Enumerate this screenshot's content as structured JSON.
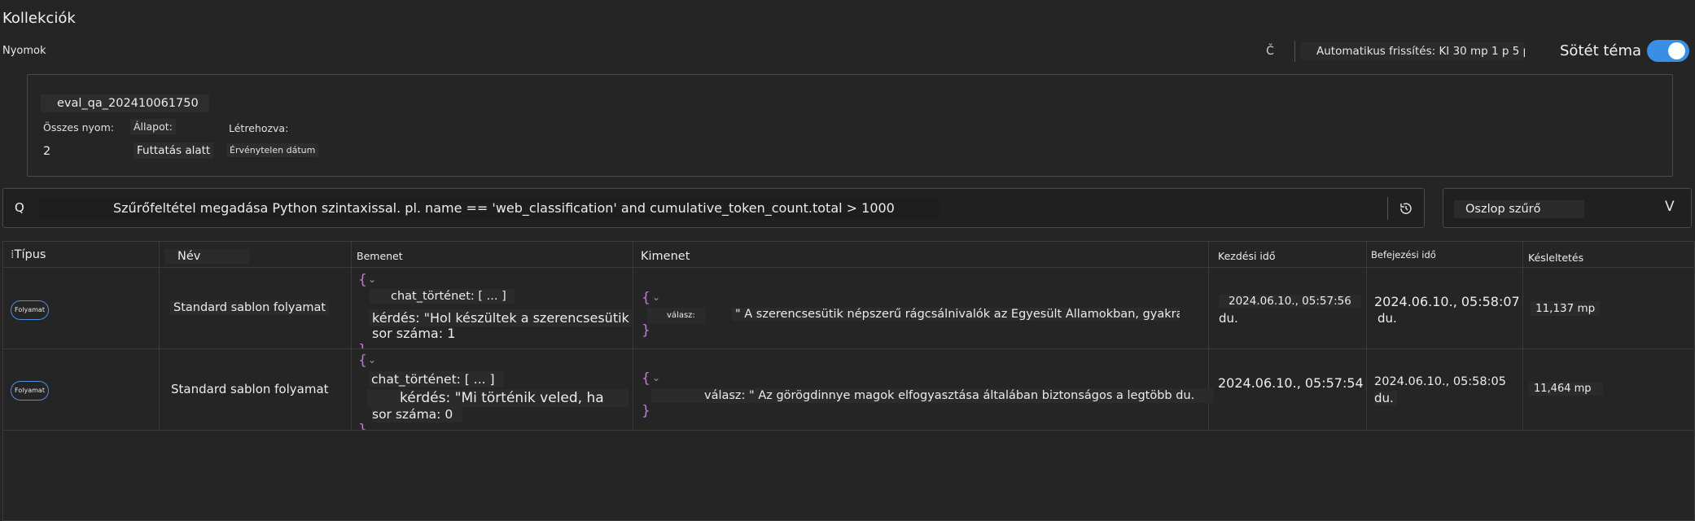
{
  "page": {
    "title": "Kollekciók",
    "subtitle": "Nyomok"
  },
  "toolbar": {
    "refresh_glyph": "Č",
    "auto_refresh": "Automatikus frissítés: KI 30 mp 1 p 5 p",
    "dark_theme_label": "Sötét téma",
    "dark_theme_on": true,
    "accent": "#3a8ee6"
  },
  "run": {
    "id": "eval_qa_202410061750",
    "total_traces_label": "Összes nyom:",
    "total_traces": "2",
    "status_label": "Állapot:",
    "status": "Futtatás alatt",
    "created_label": "Létrehozva:",
    "created": "Érvénytelen dátum"
  },
  "filter": {
    "search_glyph": "Q",
    "placeholder": "Szűrőfeltétel megadása Python szintaxissal. pl. name == 'web_classification' and cumulative_token_count.total > 1000",
    "history_icon": "history-icon",
    "column_filter": "Oszlop szűrő",
    "column_filter_chevron": "V"
  },
  "table": {
    "columns": {
      "type": "Típus",
      "name": "Név",
      "input": "Bemenet",
      "output": "Kimenet",
      "start": "Kezdési idő",
      "end": "Befejezési idő",
      "latency": "Késleltetés"
    },
    "rows": [
      {
        "type": "Folyamat",
        "name": "Standard sablon folyamat",
        "input_open": "{",
        "input_history": "chat_történet: [ ... ]",
        "input_question": "kérdés: \"Hol készültek a szerencsesütik",
        "input_line": "sor száma: 1",
        "input_close": "}",
        "output_open": "{",
        "output_key": "válasz:",
        "output_value": "\" A szerencsesütik népszerű rágcsálnivalók az Egyesült Államokban, gyakran",
        "output_close": "}",
        "start_line1": "2024.06.10., 05:57:56",
        "start_line2": "du.",
        "end_line1": "2024.06.10., 05:58:07",
        "end_line2": "du.",
        "latency": "11,137 mp"
      },
      {
        "type": "Folyamat",
        "name": "Standard sablon folyamat",
        "input_open": "{",
        "input_history": "chat_történet: [ ... ]",
        "input_question": "kérdés: \"Mi történik veled, ha",
        "input_line": "sor száma: 0",
        "input_close": "}",
        "output_open": "{",
        "output_key": "válasz:",
        "output_value": "\" Az görögdinnye magok elfogyasztása általában biztonságos a legtöbb du.",
        "output_close": "}",
        "start_line1": "2024.06.10., 05:57:54",
        "start_line2": "",
        "end_line1": "2024.06.10., 05:58:05",
        "end_line2": "du.",
        "latency": "11,464 mp"
      }
    ]
  }
}
